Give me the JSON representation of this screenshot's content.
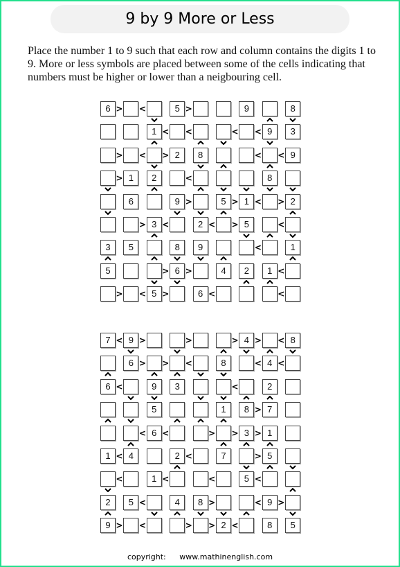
{
  "title": "9 by 9 More or Less",
  "instructions": "Place the number 1 to 9 such that each row and column contains the digits 1 to 9. More or less symbols are placed between some of the cells indicating that numbers must be higher or lower than a neigbouring cell.",
  "footer": {
    "copyright_label": "copyright:",
    "website": "www.mathinenglish.com"
  },
  "colors": {
    "border": "#22e08c",
    "title_bg": "#f2f2f2"
  },
  "puzzles": [
    {
      "cells": [
        [
          "6",
          "",
          "",
          "5",
          "",
          "",
          "9",
          "",
          "8"
        ],
        [
          "",
          "",
          "1",
          "",
          "",
          "",
          "",
          "9",
          "3"
        ],
        [
          "",
          "",
          "",
          "2",
          "8",
          "",
          "",
          "",
          "9"
        ],
        [
          "",
          "1",
          "2",
          "",
          "",
          "",
          "",
          "8",
          ""
        ],
        [
          "",
          "6",
          "",
          "9",
          "",
          "5",
          "1",
          "",
          "2"
        ],
        [
          "",
          "",
          "3",
          "",
          "2",
          "",
          "5",
          "",
          ""
        ],
        [
          "3",
          "5",
          "",
          "8",
          "9",
          "",
          "",
          "",
          "1"
        ],
        [
          "5",
          "",
          "",
          "6",
          "",
          "4",
          "2",
          "1",
          ""
        ],
        [
          "",
          "",
          "5",
          "",
          "6",
          "",
          "",
          "",
          ""
        ]
      ],
      "h_symbols": [
        [
          ">",
          "<",
          "",
          ">",
          "",
          "",
          "",
          "",
          ""
        ],
        [
          "",
          "",
          "<",
          "<",
          "",
          "<",
          "<",
          "",
          ""
        ],
        [
          ">",
          "<",
          ">",
          "",
          "",
          "",
          "<",
          "<",
          ""
        ],
        [
          ">",
          "",
          "",
          "<",
          "",
          "",
          "",
          "",
          ""
        ],
        [
          "",
          "",
          "",
          ">",
          "",
          ">",
          "<",
          ">",
          ""
        ],
        [
          "",
          ">",
          "<",
          "",
          "<",
          ">",
          "",
          "<",
          ""
        ],
        [
          "",
          "",
          "",
          "",
          "",
          "",
          "<",
          "",
          ""
        ],
        [
          "",
          "",
          ">",
          ">",
          "",
          "",
          "",
          "<",
          ""
        ],
        [
          ">",
          "<",
          ">",
          "",
          "<",
          "",
          "",
          "<",
          ""
        ]
      ],
      "v_symbols": [
        [
          "",
          "",
          "v",
          "",
          "",
          "",
          "",
          "^",
          "v"
        ],
        [
          "",
          "",
          "^",
          "",
          "^",
          "v",
          "",
          "v",
          ""
        ],
        [
          "",
          "",
          "v",
          "",
          "v",
          "^",
          "",
          "^",
          ""
        ],
        [
          "v",
          "",
          "^",
          "",
          "^",
          "v",
          "v",
          "v",
          "v"
        ],
        [
          "v",
          "",
          "",
          "v",
          "v",
          "^",
          "",
          "",
          "^"
        ],
        [
          "",
          "",
          "^",
          "",
          "",
          "",
          "v",
          "^",
          "v"
        ],
        [
          "^",
          "",
          "^",
          "v",
          "v",
          "^",
          "",
          "",
          "^"
        ],
        [
          "",
          "",
          "v",
          "v",
          "",
          "",
          "^",
          "^",
          ""
        ]
      ]
    },
    {
      "cells": [
        [
          "7",
          "9",
          "",
          "",
          "",
          "",
          "4",
          "",
          "8"
        ],
        [
          "",
          "6",
          "",
          "",
          "",
          "8",
          "",
          "4",
          ""
        ],
        [
          "6",
          "",
          "9",
          "3",
          "",
          "",
          "",
          "2",
          ""
        ],
        [
          "",
          "",
          "5",
          "",
          "",
          "1",
          "8",
          "7",
          ""
        ],
        [
          "",
          "",
          "6",
          "",
          "",
          "",
          "3",
          "1",
          ""
        ],
        [
          "1",
          "4",
          "",
          "2",
          "",
          "7",
          "",
          "5",
          ""
        ],
        [
          "",
          "",
          "1",
          "",
          "",
          "",
          "5",
          "",
          ""
        ],
        [
          "2",
          "5",
          "",
          "4",
          "8",
          "",
          "",
          "9",
          ""
        ],
        [
          "9",
          "",
          "",
          "",
          "",
          "2",
          "",
          "8",
          "5"
        ]
      ],
      "h_symbols": [
        [
          "<",
          ">",
          "",
          ">",
          "",
          ">",
          ">",
          "<",
          ""
        ],
        [
          "",
          ">",
          ">",
          "<",
          "",
          "",
          "<",
          "<",
          ""
        ],
        [
          "<",
          "",
          "",
          "",
          "",
          "<",
          "",
          "",
          ""
        ],
        [
          "",
          "",
          "",
          "",
          "",
          "",
          ">",
          "",
          ""
        ],
        [
          "",
          "<",
          "<",
          "",
          ">",
          ">",
          ">",
          "",
          ""
        ],
        [
          "<",
          "",
          "",
          "<",
          "",
          "",
          ">",
          "",
          ""
        ],
        [
          "<",
          "",
          "<",
          "",
          "<",
          "",
          "<",
          "",
          ""
        ],
        [
          "",
          "<",
          "",
          "",
          ">",
          "",
          "<",
          ">",
          ""
        ],
        [
          ">",
          "<",
          "",
          ">",
          ">",
          "<",
          "",
          "",
          ""
        ]
      ],
      "v_symbols": [
        [
          "",
          "v",
          "",
          "v",
          "",
          "^",
          "v",
          "^",
          "v"
        ],
        [
          "^",
          "",
          "^",
          "^",
          "v",
          "v",
          "",
          "",
          ""
        ],
        [
          "",
          "v",
          "v",
          "",
          "v",
          "v",
          "^",
          "^",
          ""
        ],
        [
          "^",
          "v",
          "",
          "^",
          "^",
          "^",
          "",
          "",
          ""
        ],
        [
          "",
          "^",
          "",
          "",
          "",
          "^",
          "^",
          "^",
          ""
        ],
        [
          "",
          "",
          "",
          "^",
          "",
          "",
          "v",
          "^",
          "v"
        ],
        [
          "v",
          "",
          "",
          "",
          "",
          "",
          "",
          "",
          "^"
        ],
        [
          "^",
          "",
          "v",
          "^",
          "v",
          "v",
          "^",
          "",
          "v"
        ]
      ]
    }
  ]
}
